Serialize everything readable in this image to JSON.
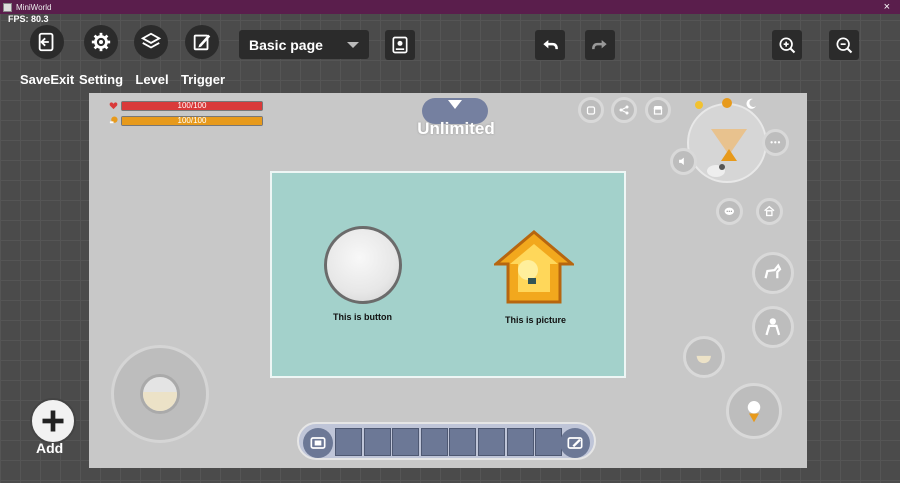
{
  "window": {
    "title": "MiniWorld",
    "close_glyph": "×",
    "fps": "FPS: 80.3"
  },
  "toolbar": {
    "save_exit": "SaveExit",
    "setting": "Setting",
    "level": "Level",
    "trigger": "Trigger",
    "page_select": "Basic page"
  },
  "hud": {
    "health": "100/100",
    "hunger": "100/100",
    "health_value": 1.0,
    "hunger_value": 1.0,
    "mode": "Unlimited"
  },
  "dialog": {
    "button_label": "This is button",
    "picture_label": "This is picture"
  },
  "hotbar": {
    "slot_count": 8
  },
  "add": {
    "label": "Add"
  },
  "colors": {
    "titlebar": "#5a1e4c",
    "health": "#d93a3a",
    "hunger": "#e79a1c",
    "dialog_bg": "#a3d1cb",
    "slot": "#6c7896"
  }
}
